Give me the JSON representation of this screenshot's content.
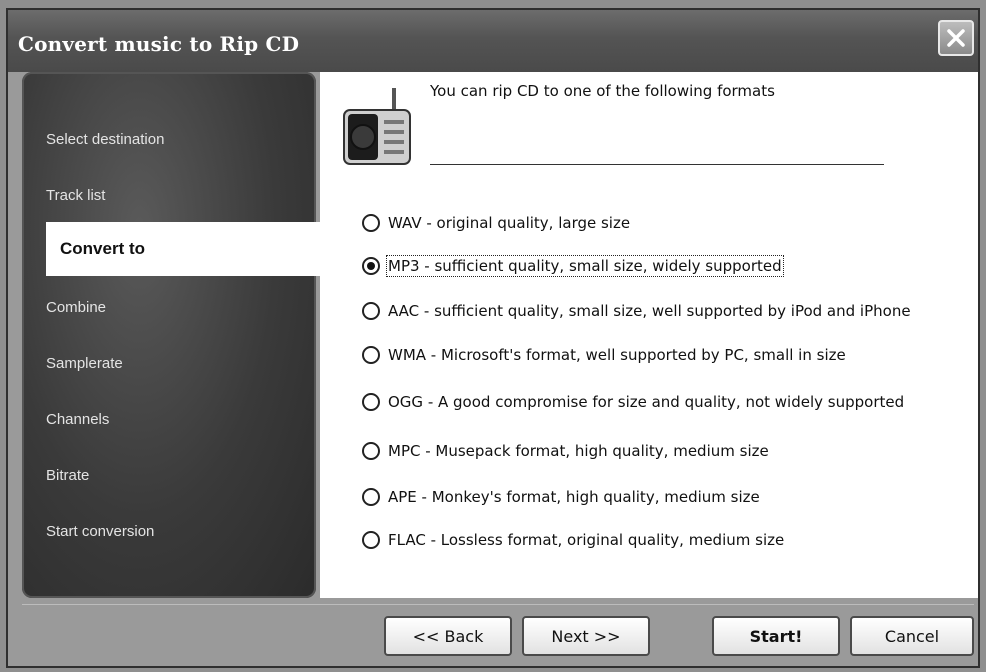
{
  "window": {
    "title": "Convert music to Rip CD"
  },
  "nav": {
    "items": [
      {
        "label": "Select destination"
      },
      {
        "label": "Track list"
      },
      {
        "label": "Convert to"
      },
      {
        "label": "Combine"
      },
      {
        "label": "Samplerate"
      },
      {
        "label": "Channels"
      },
      {
        "label": "Bitrate"
      },
      {
        "label": "Start conversion"
      }
    ],
    "active_index": 2
  },
  "content": {
    "heading": "You can rip CD to one of the following formats",
    "options": [
      {
        "label": "WAV - original quality, large size",
        "checked": false
      },
      {
        "label": "MP3 -  sufficient quality, small size, widely supported",
        "checked": true
      },
      {
        "label": "AAC - sufficient quality, small size, well supported by iPod and iPhone",
        "checked": false
      },
      {
        "label": "WMA - Microsoft's format, well supported by PC, small in size",
        "checked": false
      },
      {
        "label": "OGG - A good compromise for size and quality, not widely supported",
        "checked": false
      },
      {
        "label": "MPC - Musepack format, high quality, medium size",
        "checked": false
      },
      {
        "label": "APE - Monkey's format, high quality, medium size",
        "checked": false
      },
      {
        "label": "FLAC - Lossless format, original quality, medium size",
        "checked": false
      }
    ]
  },
  "footer": {
    "back_label": "<< Back",
    "next_label": "Next >>",
    "start_label": "Start!",
    "cancel_label": "Cancel"
  },
  "icons": {
    "close": "close-icon",
    "radio": "radio-icon"
  }
}
